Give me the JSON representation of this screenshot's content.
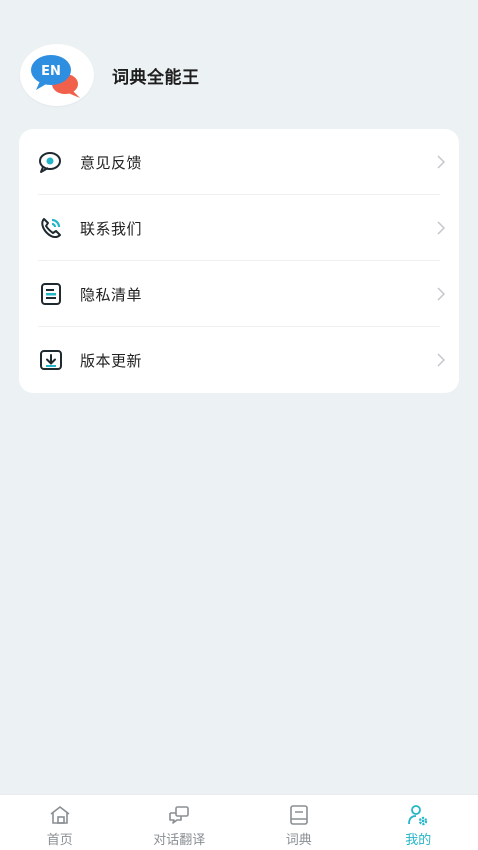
{
  "profile": {
    "app_name": "词典全能王",
    "avatar_badge": "EN"
  },
  "menu": [
    {
      "label": "意见反馈",
      "icon": "feedback-icon"
    },
    {
      "label": "联系我们",
      "icon": "phone-icon"
    },
    {
      "label": "隐私清单",
      "icon": "document-icon"
    },
    {
      "label": "版本更新",
      "icon": "download-icon"
    }
  ],
  "tabs": [
    {
      "label": "首页",
      "icon": "home-icon",
      "active": false
    },
    {
      "label": "对话翻译",
      "icon": "chat-translate-icon",
      "active": false
    },
    {
      "label": "词典",
      "icon": "book-icon",
      "active": false
    },
    {
      "label": "我的",
      "icon": "user-settings-icon",
      "active": true
    }
  ],
  "colors": {
    "accent": "#25b5c8",
    "background": "#ecf1f4",
    "avatar_bubble_blue": "#2e8fe0",
    "avatar_bubble_red": "#f0604a"
  }
}
